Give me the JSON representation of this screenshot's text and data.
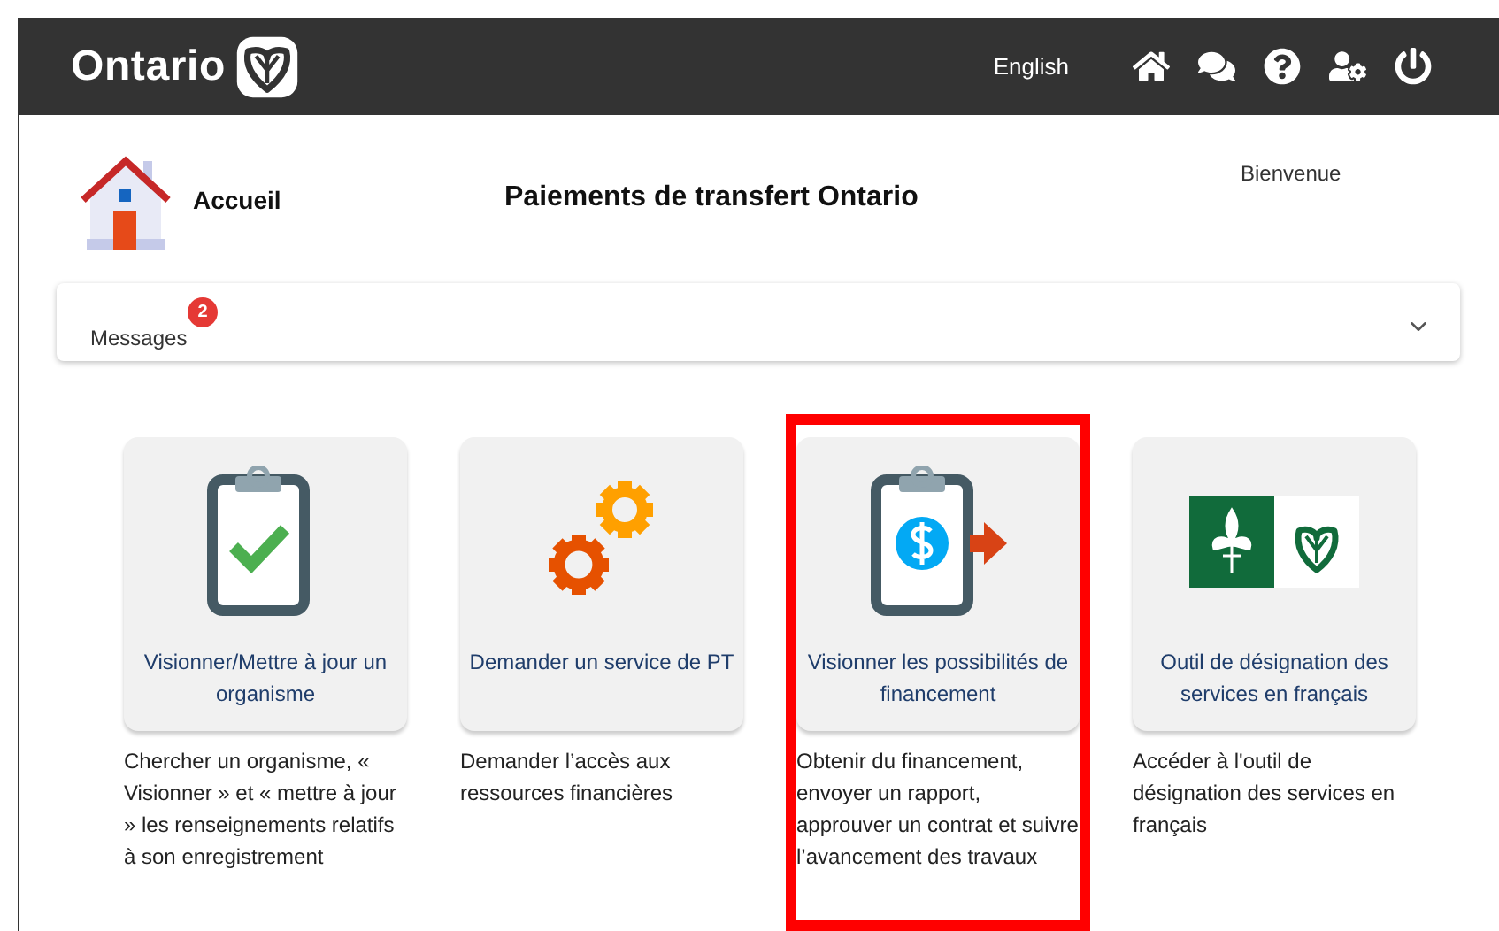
{
  "header": {
    "logo": "Ontario",
    "language_link": "English"
  },
  "page": {
    "home_label": "Accueil",
    "title": "Paiements de transfert Ontario",
    "welcome": "Bienvenue"
  },
  "messages": {
    "label": "Messages",
    "count": "2",
    "expanded": false
  },
  "tiles": [
    {
      "kind": "clipboard-check",
      "label": "Visionner/Mettre à jour un organisme",
      "description": "Chercher un organisme, « Visionner » et « mettre à jour » les renseignements relatifs à son enregistrement",
      "highlighted": false
    },
    {
      "kind": "gears",
      "label": "Demander un service de PT",
      "description": "Demander l’accès aux ressources financières",
      "highlighted": false
    },
    {
      "kind": "clipboard-dollar",
      "label": "Visionner les possibilités de financement",
      "description": "Obtenir du financement, envoyer un rapport, approuver un contrat et suivre l’avancement des travaux",
      "highlighted": true
    },
    {
      "kind": "french-flag",
      "label": "Outil de désignation des services en français",
      "description": "Accéder à l'outil de désignation des services en français",
      "highlighted": false
    }
  ]
}
